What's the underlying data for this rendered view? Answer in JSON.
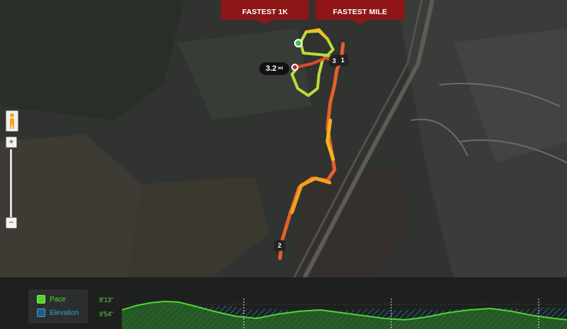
{
  "tabs": {
    "fastest_1k": "FASTEST 1K",
    "fastest_mile": "FASTEST MILE"
  },
  "distance": {
    "value": "3.2",
    "unit": "mi"
  },
  "mile_markers": [
    "1",
    "2",
    "3"
  ],
  "zoom": {
    "plus": "+",
    "minus": "−"
  },
  "chart": {
    "legend": {
      "pace": "Pace",
      "elevation": "Elevation"
    },
    "pace_labels": [
      "8'13\"",
      "9'54\""
    ],
    "colors": {
      "pace": "#4fd630",
      "elevation": "#2c8fc8"
    }
  }
}
